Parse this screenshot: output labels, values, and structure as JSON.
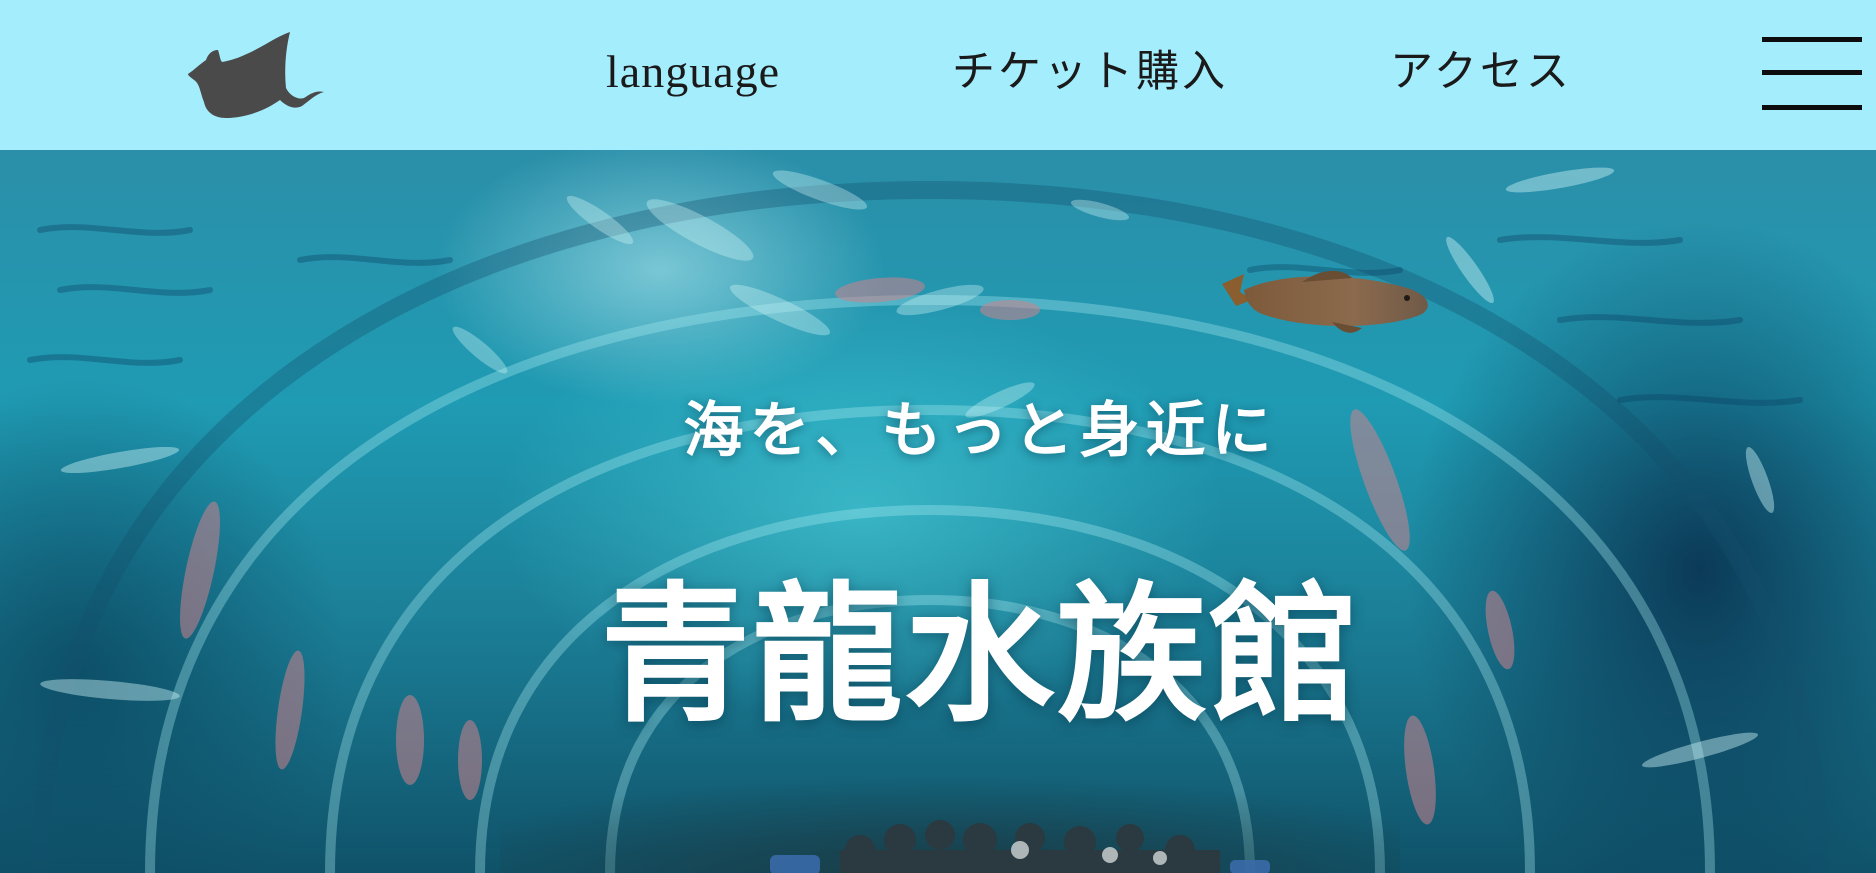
{
  "header": {
    "logo_icon": "manta-ray-icon",
    "nav": {
      "language": "language",
      "ticket": "チケット購入",
      "access": "アクセス"
    },
    "menu_icon": "hamburger-menu-icon",
    "background_color": "#a4edfd"
  },
  "hero": {
    "tagline": "海を、もっと身近に",
    "title": "青龍水族館",
    "background_image": "aquarium-tunnel-photo",
    "accent_color": "#1f9bb3"
  }
}
